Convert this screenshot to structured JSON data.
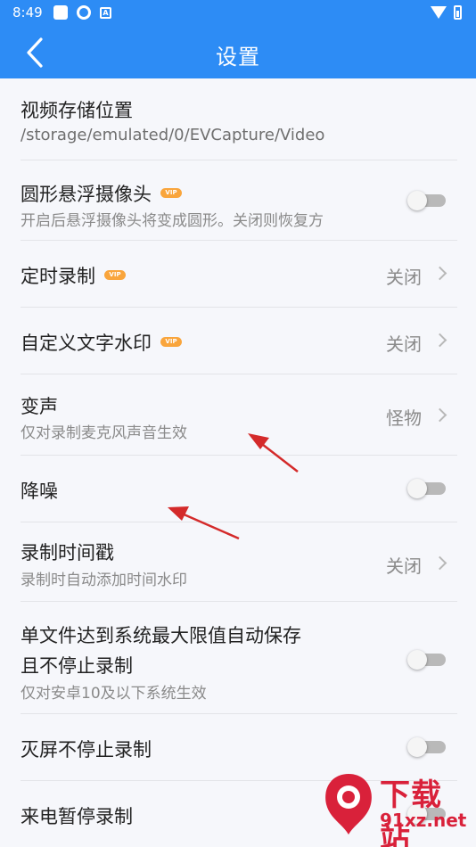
{
  "status_bar": {
    "time": "8:49"
  },
  "app_bar": {
    "title": "设置"
  },
  "vip_badge": "VIP",
  "rows": [
    {
      "label": "视频存储位置",
      "sub": "/storage/emulated/0/EVCapture/Video"
    },
    {
      "label": "圆形悬浮摄像头",
      "sub": "开启后悬浮摄像头将变成圆形。关闭则恢复方",
      "toggle": "off"
    },
    {
      "label": "定时录制",
      "value": "关闭"
    },
    {
      "label": "自定义文字水印",
      "value": "关闭"
    },
    {
      "label": "变声",
      "sub": "仅对录制麦克风声音生效",
      "value": "怪物"
    },
    {
      "label": "降噪",
      "toggle": "off"
    },
    {
      "label": "录制时间戳",
      "sub": "录制时自动添加时间水印",
      "value": "关闭"
    },
    {
      "label_line1": "单文件达到系统最大限值自动保存",
      "label_line2": "且不停止录制",
      "sub": "仅对安卓10及以下系统生效",
      "toggle": "off"
    },
    {
      "label": "灭屏不停止录制",
      "toggle": "off"
    },
    {
      "label": "来电暂停录制",
      "toggle": "off"
    }
  ],
  "watermark": {
    "text": "下载站",
    "url": "91xz.net"
  },
  "colors": {
    "app_bar": "#2d8cf5",
    "vip": "#f9a53c",
    "arrow": "#d42a2a",
    "watermark": "#d9213a"
  }
}
